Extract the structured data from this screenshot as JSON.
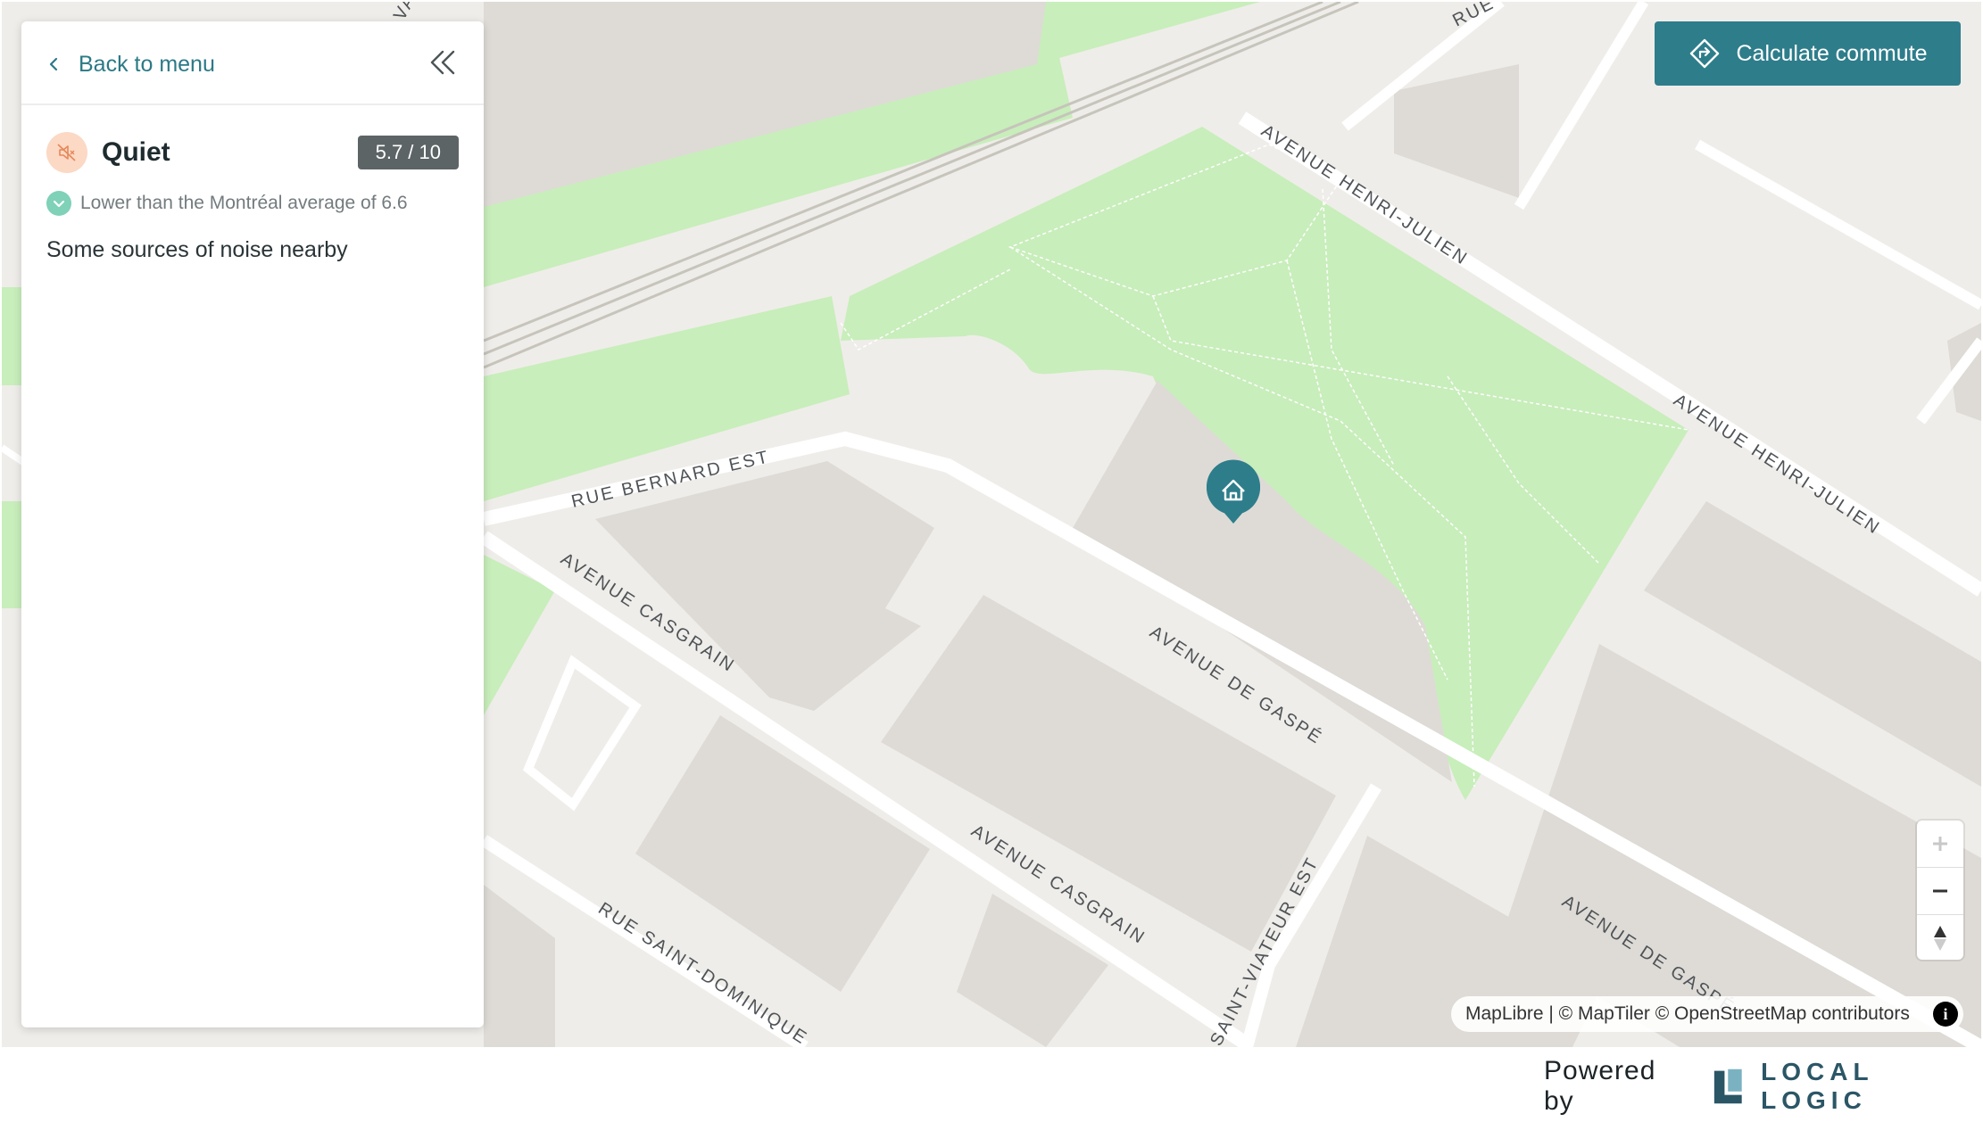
{
  "panel": {
    "back_label": "Back to menu",
    "metric": {
      "title": "Quiet",
      "score": "5.7 / 10",
      "comparison": "Lower than the Montréal average of 6.6",
      "description": "Some sources of noise nearby"
    }
  },
  "commute_button": {
    "label": "Calculate commute"
  },
  "map": {
    "street_labels": {
      "rue_bernard_est": "RUE BERNARD EST",
      "henri_julien_1": "AVENUE HENRI-JULIEN",
      "henri_julien_2": "AVENUE HENRI-JULIEN",
      "casgrain_1": "AVENUE CASGRAIN",
      "casgrain_2": "AVENUE CASGRAIN",
      "de_gaspe_1": "AVENUE DE GASPÉ",
      "de_gaspe_2": "AVENUE DE GASPÉ",
      "saint_dominique": "RUE SAINT-DOMINIQUE",
      "saint_viateur": "SAINT-VIATEUR EST",
      "rue_top": "RUE",
      "partial_top": "VAR"
    },
    "attribution": "MapLibre | © MapTiler © OpenStreetMap contributors",
    "colors": {
      "park": "#c8eebb",
      "building": "#dedbd6",
      "road": "#ffffff",
      "land": "#efede9",
      "marker": "#2e7d8b"
    }
  },
  "footer": {
    "powered_by": "Powered by",
    "brand": "LOCAL LOGIC"
  }
}
